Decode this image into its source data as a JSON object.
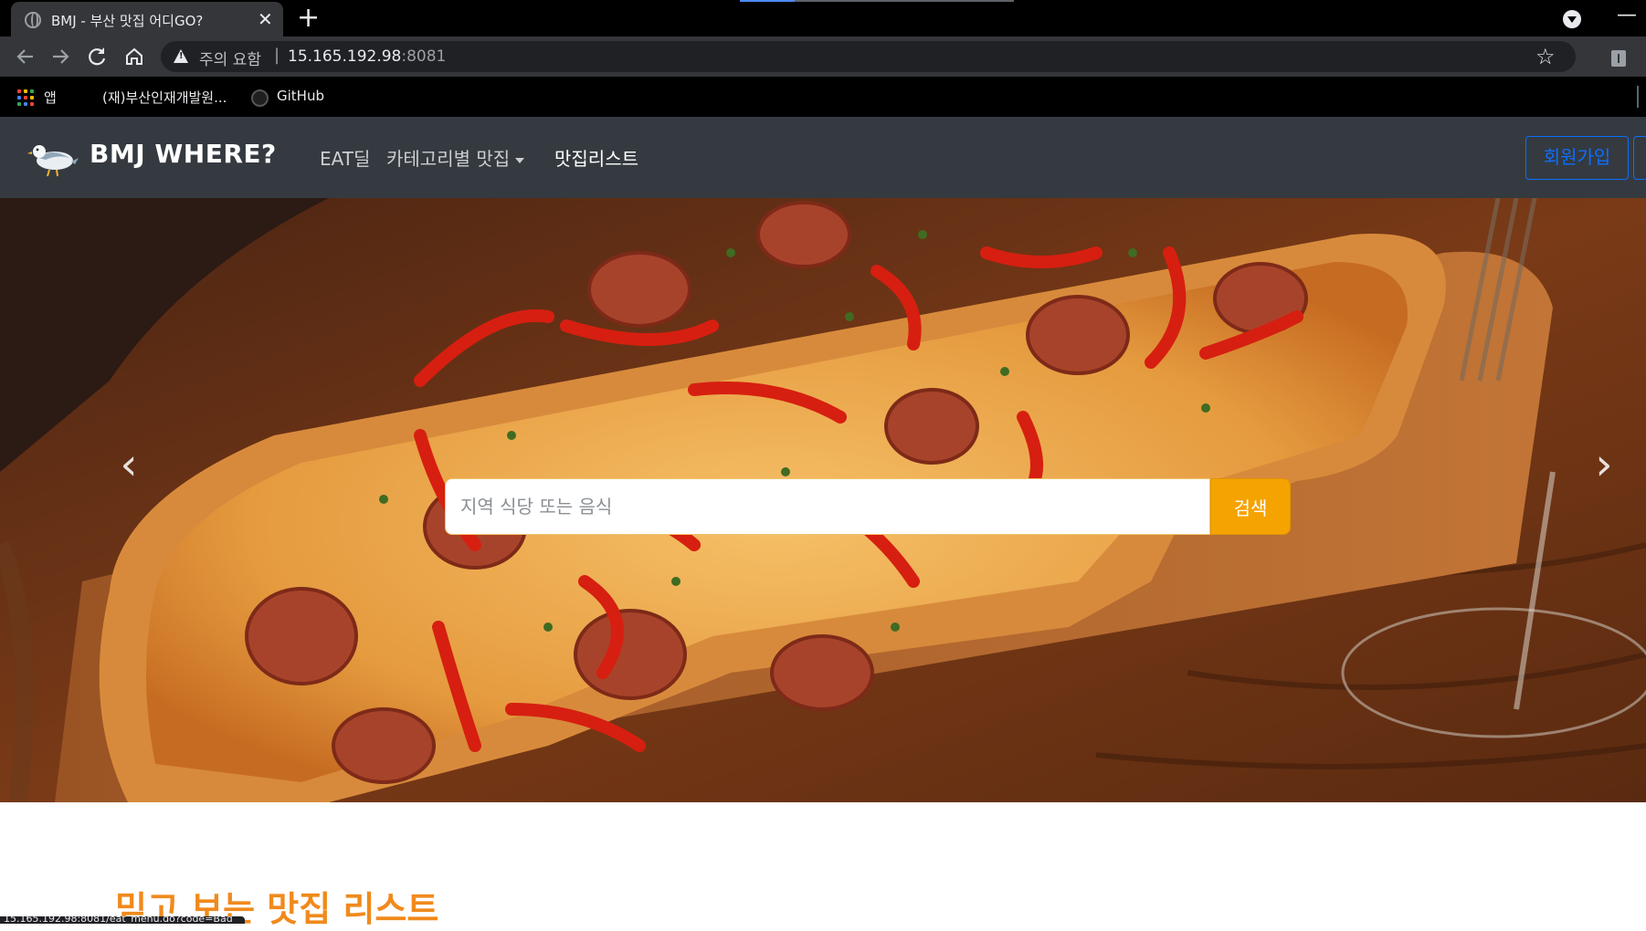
{
  "browser": {
    "tab_title": "BMJ - 부산 맛집 어디GO?",
    "tab_close": "✕",
    "new_tab": "+",
    "minimize": "—",
    "security_warning": "주의 요함",
    "url_separator": "|",
    "url_host": "15.165.192.98",
    "url_port": ":8081",
    "bookmarks": {
      "apps_label": "앱",
      "item1": "(재)부산인재개발원...",
      "item2": "GitHub"
    },
    "status_url": "15.165.192.98:8081/eat_menu.do?code=Bad"
  },
  "navbar": {
    "brand": "BMJ WHERE?",
    "links": {
      "eat_deal": "EAT딜",
      "category": "카테고리별 맛집",
      "list": "맛집리스트"
    },
    "signup": "회원가입"
  },
  "hero": {
    "prev": "‹",
    "next": "›",
    "search_placeholder": "지역 식당 또는 음식",
    "search_button": "검색"
  },
  "section": {
    "title": "믿고 보는 맛집 리스트"
  },
  "colors": {
    "navbar_bg": "#343a40",
    "search_button": "#f5a300",
    "section_title": "#f08a1c",
    "signup_border": "#0d6efd"
  },
  "icons": [
    "globe-icon",
    "back-arrow-icon",
    "forward-arrow-icon",
    "reload-icon",
    "home-icon",
    "warning-icon",
    "star-icon",
    "extension-icon",
    "apps-grid-icon",
    "github-icon",
    "seagull-logo-icon",
    "chevron-left-icon",
    "chevron-right-icon"
  ]
}
